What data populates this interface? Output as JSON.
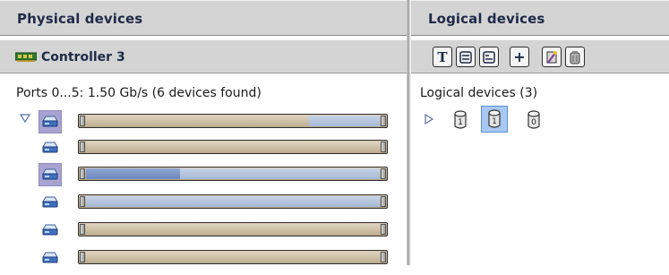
{
  "left_pane": {
    "title": "Physical devices",
    "controller": {
      "label": "Controller 3",
      "icon": "controller-card-icon"
    },
    "ports_summary": "Ports 0...5:  1.50 Gb/s  (6 devices found)",
    "devices": [
      {
        "icon": "disk-drive-icon",
        "selected": true,
        "segments": [
          {
            "type": "used",
            "start": 0,
            "end": 0.76
          },
          {
            "type": "free",
            "start": 0.76,
            "end": 1.0
          }
        ]
      },
      {
        "icon": "disk-drive-icon",
        "selected": false,
        "segments": [
          {
            "type": "used",
            "start": 0,
            "end": 1.0
          }
        ]
      },
      {
        "icon": "disk-drive-icon",
        "selected": true,
        "segments": [
          {
            "type": "used",
            "start": 0,
            "end": 1.0
          }
        ]
      },
      {
        "icon": "disk-drive-icon",
        "selected": false,
        "segments": [
          {
            "type": "free",
            "start": 0,
            "end": 1.0
          }
        ]
      },
      {
        "icon": "disk-drive-icon",
        "selected": false,
        "segments": [
          {
            "type": "used",
            "start": 0,
            "end": 1.0
          }
        ]
      },
      {
        "icon": "disk-drive-icon",
        "selected": false,
        "segments": [
          {
            "type": "used",
            "start": 0,
            "end": 1.0
          }
        ]
      }
    ]
  },
  "right_pane": {
    "title": "Logical devices",
    "toolbar": [
      {
        "name": "text-view-button",
        "icon": "text-view-icon",
        "glyph": "T"
      },
      {
        "name": "full-view-button",
        "icon": "full-view-icon",
        "glyph": ""
      },
      {
        "name": "compact-view-button",
        "icon": "compact-view-icon",
        "glyph": ""
      },
      {
        "name": "create-logical-device-button",
        "icon": "plus-icon",
        "glyph": "+"
      },
      {
        "name": "wizard-button",
        "icon": "wizard-icon",
        "glyph": ""
      },
      {
        "name": "delete-logical-device-button",
        "icon": "trash-icon",
        "glyph": ""
      }
    ],
    "logical_summary": "Logical devices (3)",
    "logical_devices": [
      {
        "label": "1",
        "selected": false
      },
      {
        "label": "1",
        "selected": true
      },
      {
        "label": "0",
        "selected": false
      }
    ]
  },
  "colors": {
    "header_bg": "#d4d4d4",
    "title_text": "#1e2a48",
    "bar_used": "#c5b79c",
    "bar_free": "#a5b8d6",
    "selection": "#a9a3d2"
  }
}
